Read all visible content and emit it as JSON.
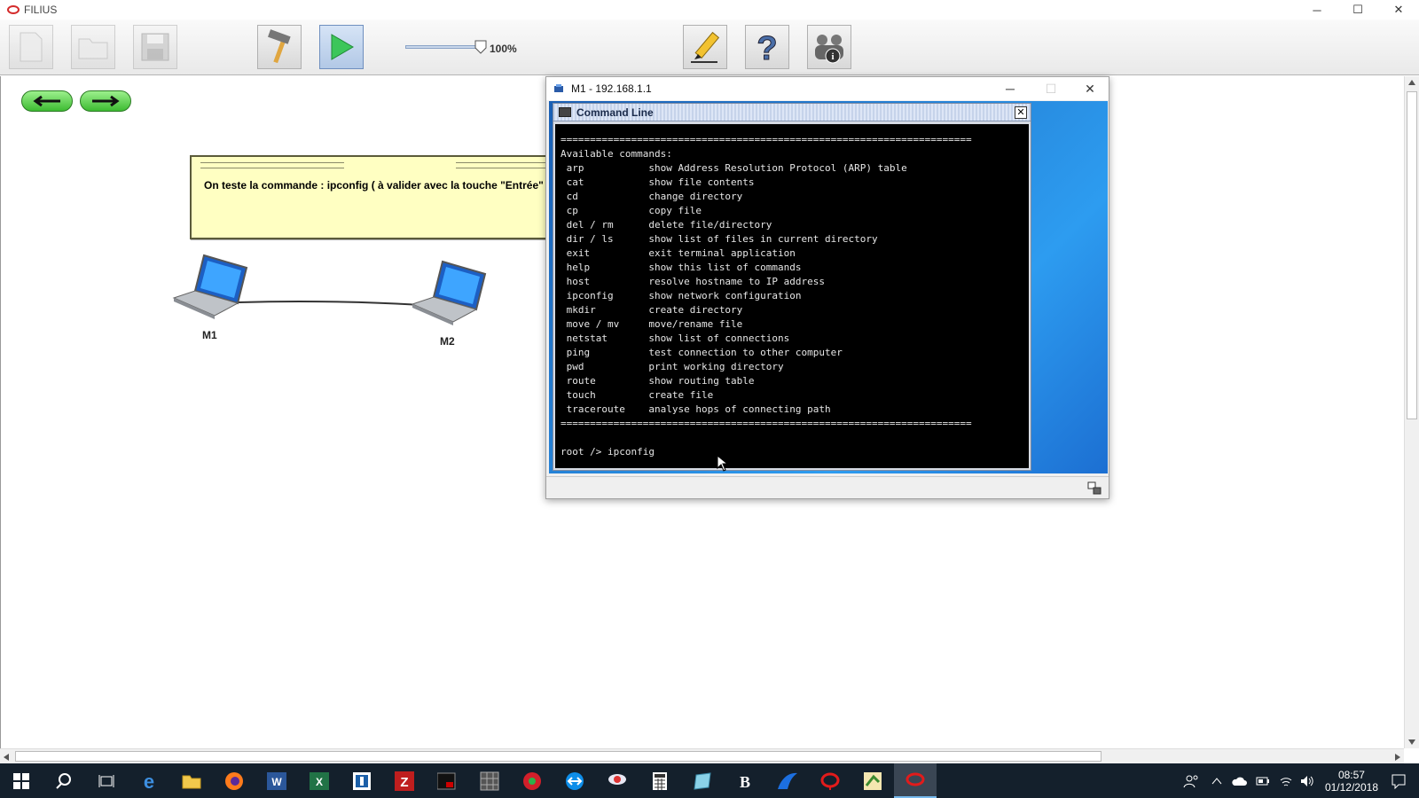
{
  "app": {
    "title": "FILIUS"
  },
  "window_controls": {
    "minimize": "─",
    "maximize": "☐",
    "close": "✕"
  },
  "toolbar": {
    "zoom_label": "100%"
  },
  "tooltip": {
    "text": "On teste la commande : ipconfig  ( à valider avec la touche \"Entrée\" )"
  },
  "nodes": {
    "m1": "M1",
    "m2": "M2"
  },
  "host_window": {
    "title": "M1 - 192.168.1.1",
    "inner_title": "Command Line",
    "close_glyph": "✕"
  },
  "terminal": {
    "separator": "======================================================================",
    "intro": "Available commands:",
    "commands": [
      {
        "cmd": "arp",
        "desc": "show Address Resolution Protocol (ARP) table"
      },
      {
        "cmd": "cat",
        "desc": "show file contents"
      },
      {
        "cmd": "cd",
        "desc": "change directory"
      },
      {
        "cmd": "cp",
        "desc": "copy file"
      },
      {
        "cmd": "del / rm",
        "desc": "delete file/directory"
      },
      {
        "cmd": "dir / ls",
        "desc": "show list of files in current directory"
      },
      {
        "cmd": "exit",
        "desc": "exit terminal application"
      },
      {
        "cmd": "help",
        "desc": "show this list of commands"
      },
      {
        "cmd": "host",
        "desc": "resolve hostname to IP address"
      },
      {
        "cmd": "ipconfig",
        "desc": "show network configuration"
      },
      {
        "cmd": "mkdir",
        "desc": "create directory"
      },
      {
        "cmd": "move / mv",
        "desc": "move/rename file"
      },
      {
        "cmd": "netstat",
        "desc": "show list of connections"
      },
      {
        "cmd": "ping",
        "desc": "test connection to other computer"
      },
      {
        "cmd": "pwd",
        "desc": "print working directory"
      },
      {
        "cmd": "route",
        "desc": "show routing table"
      },
      {
        "cmd": "touch",
        "desc": "create file"
      },
      {
        "cmd": "traceroute",
        "desc": "analyse hops of connecting path"
      }
    ],
    "prompt": "root />",
    "input_value": "ipconfig"
  },
  "taskbar": {
    "time": "08:57",
    "date": "01/12/2018"
  },
  "colors": {
    "accent_green": "#3dbb32",
    "terminal_bg": "#000000",
    "tooltip_bg": "#ffffc2",
    "taskbar_bg": "#14202c"
  }
}
